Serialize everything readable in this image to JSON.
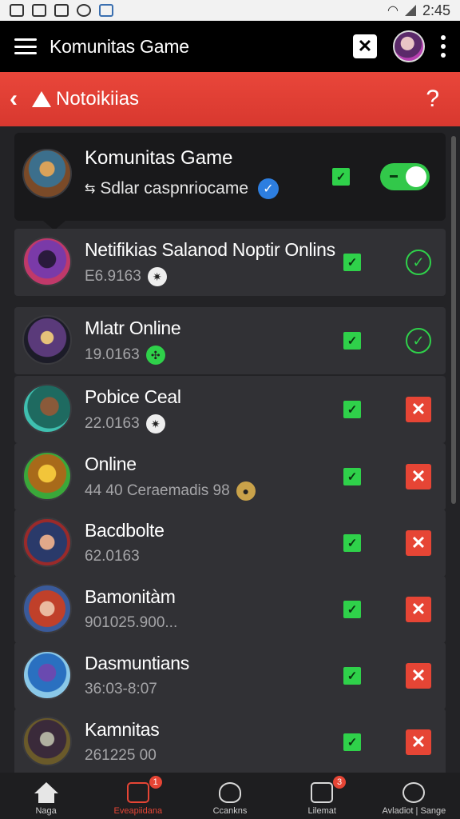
{
  "status_bar": {
    "time": "2:45"
  },
  "app": {
    "title": "Komunitas Game"
  },
  "subheader": {
    "title": "Notoikiias",
    "help": "?"
  },
  "header_card": {
    "title": "Komunitas Game",
    "subtitle": "Sdlar caspnriocame",
    "toggle_on": true,
    "checked": true
  },
  "rows": [
    {
      "title": "Netifikias Salanod Noptir Onlins",
      "meta": "E6.9163",
      "status": "ok"
    },
    {
      "title": "Mlatr Online",
      "meta": "19.0163",
      "status": "ok"
    },
    {
      "title": "Pobice Ceal",
      "meta": "22.0163",
      "status": "bad"
    },
    {
      "title": "Online",
      "meta": "44 40 Ceraemadis 98",
      "status": "bad"
    },
    {
      "title": "Bacdbolte",
      "meta": "62.0163",
      "status": "bad"
    },
    {
      "title": "Bamonitàm",
      "meta": "901025.900...",
      "status": "bad"
    },
    {
      "title": "Dasmuntians",
      "meta": "36:03-8:07",
      "status": "bad"
    },
    {
      "title": "Kamnitas",
      "meta": "261225 00",
      "status": "bad"
    }
  ],
  "bottom_nav": [
    {
      "label": "Naga",
      "active": false,
      "badge": ""
    },
    {
      "label": "Eveapiidana",
      "active": true,
      "badge": "1"
    },
    {
      "label": "Ccankns",
      "active": false,
      "badge": ""
    },
    {
      "label": "Lilemat",
      "active": false,
      "badge": "3"
    },
    {
      "label": "Avladiot | Sange",
      "active": false,
      "badge": ""
    }
  ],
  "colors": {
    "accent_red": "#e64535",
    "check_green": "#2fd14a",
    "verify_blue": "#2d7ee0"
  }
}
